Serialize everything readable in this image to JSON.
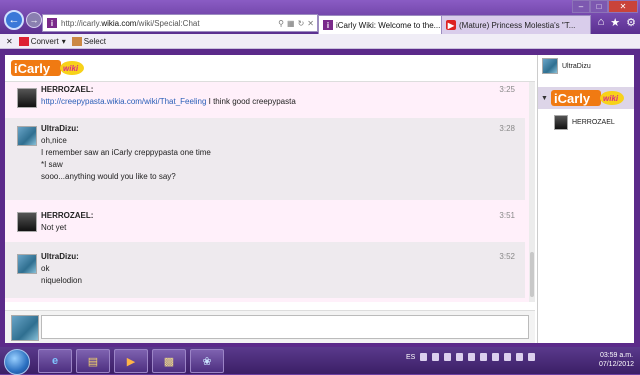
{
  "browser": {
    "address_url_prefix": "http://icarly.",
    "address_url_domain": "wikia.com",
    "address_url_suffix": "/wiki/Special:Chat",
    "tabs": [
      {
        "label": "iCarly Wiki: Welcome to the..."
      },
      {
        "label": "(Mature) Princess Molestia's \"T..."
      }
    ],
    "toolbar": {
      "convert_label": "Convert",
      "select_label": "Select"
    }
  },
  "chat": {
    "logo_text": "iCarly",
    "logo_sub": "wiki",
    "messages": [
      {
        "user": "HERROZAEL:",
        "time": "3:25",
        "link": "http://creepypasta.wikia.com/wiki/That_Feeling",
        "text": " I think good creepypasta"
      },
      {
        "user": "UltraDizu:",
        "time": "3:28",
        "lines": [
          "oh,nice",
          "I remember saw an iCarly creppypasta one time",
          "*I saw",
          "sooo...anything would you like to say?"
        ]
      },
      {
        "user": "HERROZAEL:",
        "time": "3:51",
        "lines": [
          "Not yet"
        ]
      },
      {
        "user": "UltraDizu:",
        "time": "3:52",
        "lines": [
          "ok",
          "niquelodion"
        ]
      }
    ],
    "input_value": ""
  },
  "sidebar": {
    "me": "UltraDizu",
    "room_logo": "iCarly",
    "room_logo_sub": "wiki",
    "users": [
      "HERROZAEL"
    ]
  },
  "taskbar": {
    "language": "ES",
    "time": "03:59 a.m.",
    "date": "07/12/2012"
  }
}
